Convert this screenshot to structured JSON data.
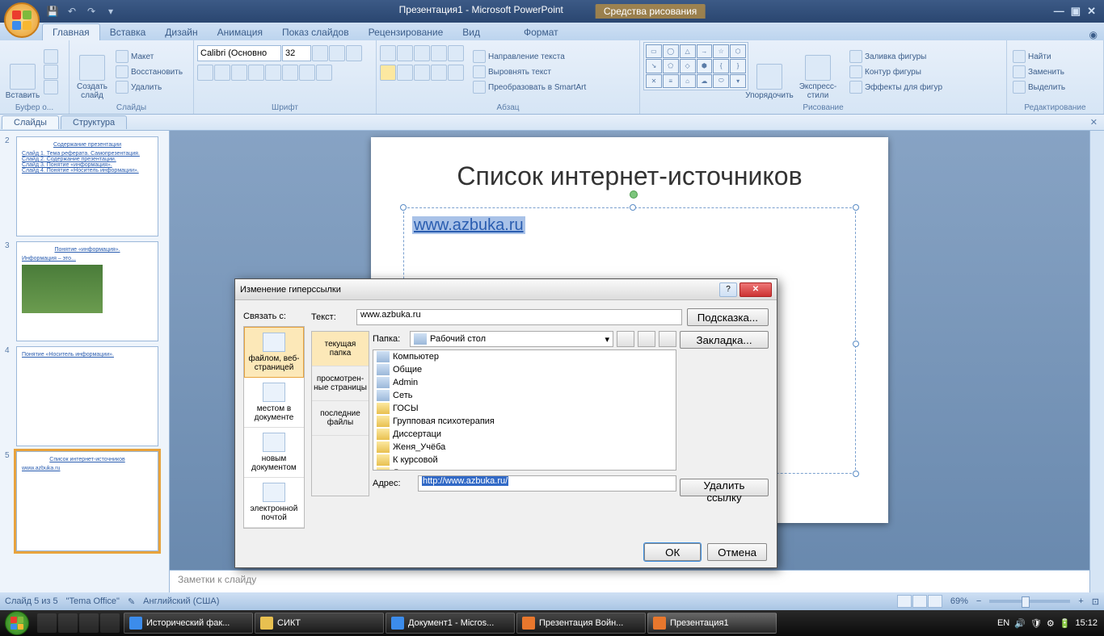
{
  "titlebar": {
    "doc_title": "Презентация1 - Microsoft PowerPoint",
    "context_tools": "Средства рисования",
    "minimize": "—",
    "maximize": "▣",
    "close": "✕"
  },
  "ribbon_tabs": [
    "Главная",
    "Вставка",
    "Дизайн",
    "Анимация",
    "Показ слайдов",
    "Рецензирование",
    "Вид",
    "Формат"
  ],
  "ribbon": {
    "clipboard": {
      "paste": "Вставить",
      "label": "Буфер о..."
    },
    "slides": {
      "new": "Создать\nслайд",
      "layout": "Макет",
      "reset": "Восстановить",
      "delete": "Удалить",
      "label": "Слайды"
    },
    "font": {
      "family": "Calibri (Основно",
      "size": "32",
      "label": "Шрифт"
    },
    "para": {
      "dir": "Направление текста",
      "align": "Выровнять текст",
      "convert": "Преобразовать в SmartArt",
      "label": "Абзац"
    },
    "draw": {
      "arrange": "Упорядочить",
      "styles": "Экспресс-стили",
      "fill": "Заливка фигуры",
      "outline": "Контур фигуры",
      "effects": "Эффекты для фигур",
      "label": "Рисование"
    },
    "edit": {
      "find": "Найти",
      "replace": "Заменить",
      "select": "Выделить",
      "label": "Редактирование"
    }
  },
  "panes": {
    "slides": "Слайды",
    "outline": "Структура"
  },
  "thumbs": [
    {
      "n": "2",
      "title": "Содержание презентации",
      "lines": [
        "Слайд 1. Тема реферата. Самопрезентация.",
        "Слайд 2. Содержание презентации.",
        "Слайд 3. Понятие «информация».",
        "Слайд 4. Понятие «Носитель информации»."
      ]
    },
    {
      "n": "3",
      "title": "Понятие «информация».",
      "lines": [
        "Информация – это..."
      ],
      "img": true
    },
    {
      "n": "4",
      "title": "",
      "lines": [
        "Понятие «Носитель информации»."
      ]
    },
    {
      "n": "5",
      "title": "Список интернет-источников",
      "lines": [
        "www.azbuka.ru"
      ],
      "sel": true
    }
  ],
  "slide": {
    "title": "Список интернет-источников",
    "link": "www.azbuka.ru"
  },
  "notes_placeholder": "Заметки к слайду",
  "status": {
    "slide": "Слайд 5 из 5",
    "theme": "\"Tema Office\"",
    "lang": "Английский (США)",
    "zoom": "69%"
  },
  "dialog": {
    "title": "Изменение гиперссылки",
    "link_with": "Связать с:",
    "text_lbl": "Текст:",
    "text_val": "www.azbuka.ru",
    "tooltip_btn": "Подсказка...",
    "types": [
      "файлом, веб-страницей",
      "местом в документе",
      "новым документом",
      "электронной почтой"
    ],
    "folder_lbl": "Папка:",
    "folder_val": "Рабочий стол",
    "browse_tabs": [
      "текущая папка",
      "просмотрен-ные страницы",
      "последние файлы"
    ],
    "files": [
      "Компьютер",
      "Общие",
      "Admin",
      "Сеть",
      "ГОСЫ",
      "Групповая психотерапия",
      "Диссертаци",
      "Женя_Учёба",
      "К курсовой",
      "Личность преподавателя"
    ],
    "bookmark": "Закладка...",
    "address_lbl": "Адрес:",
    "address_val": "http://www.azbuka.ru/",
    "remove": "Удалить ссылку",
    "ok": "ОК",
    "cancel": "Отмена"
  },
  "taskbar": {
    "items": [
      {
        "label": "Исторический фак...",
        "ic": "#3c8ceb"
      },
      {
        "label": "СИКТ",
        "ic": "#e8c050"
      },
      {
        "label": "Документ1 - Micros...",
        "ic": "#3c8ceb"
      },
      {
        "label": "Презентация Войн...",
        "ic": "#e8772d"
      },
      {
        "label": "Презентация1",
        "ic": "#e8772d",
        "active": true
      }
    ],
    "lang": "EN",
    "time": "15:12"
  }
}
